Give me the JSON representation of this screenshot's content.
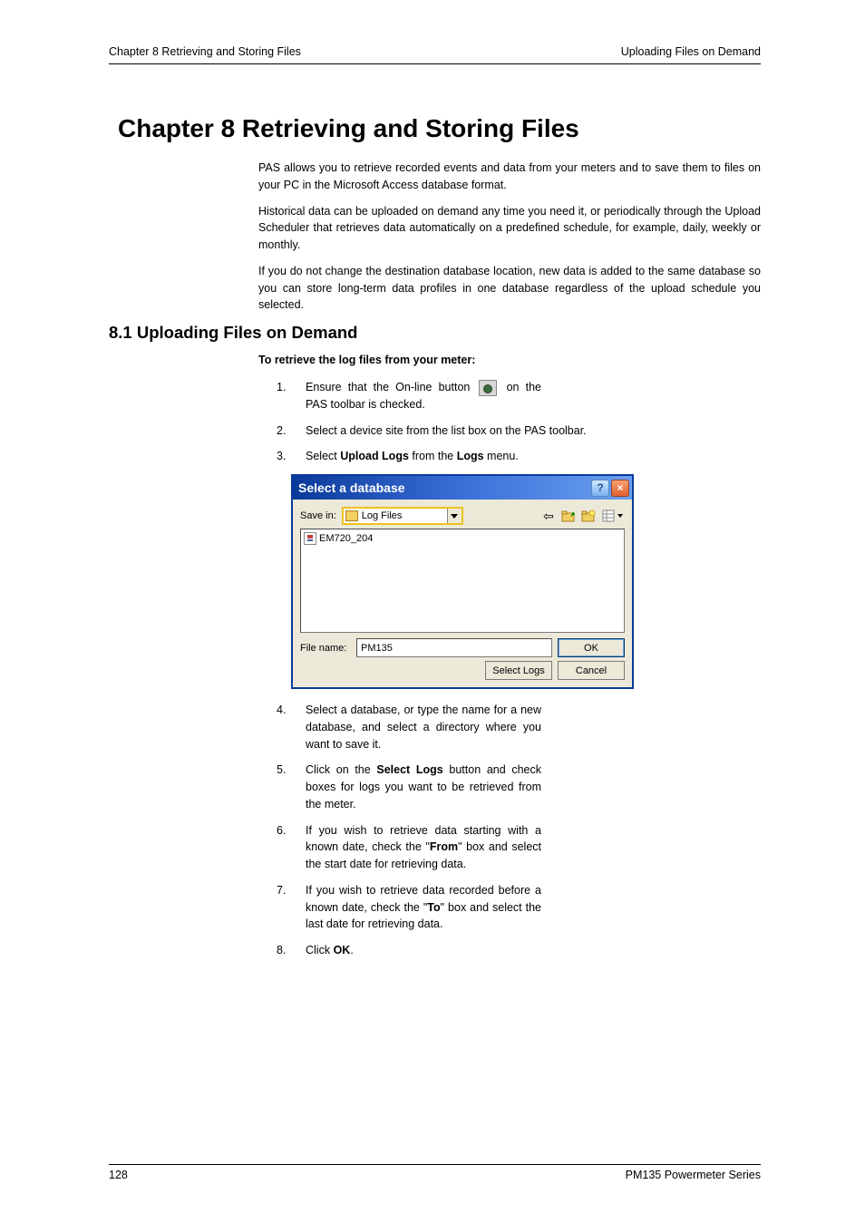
{
  "header": {
    "left": "Chapter 8   Retrieving and Storing Files",
    "right": "Uploading Files on Demand"
  },
  "chapter_title": "Chapter 8   Retrieving and Storing Files",
  "intro": {
    "p1": "PAS allows you to retrieve recorded events and data from your meters and to save them to files on your PC in the Microsoft Access database format.",
    "p2": "Historical data can be uploaded on demand any time you need it, or periodically through the Upload Scheduler that retrieves data automatically on a predefined schedule, for example, daily, weekly or monthly.",
    "p3": "If you do not change the destination database location, new data is added to the same database so you can store long-term data profiles in one database regardless of the upload schedule you selected."
  },
  "section": {
    "title": "8.1  Uploading Files on Demand",
    "sub_heading": "To retrieve the log files from your meter:",
    "steps": {
      "s1a": "Ensure that the On-line button ",
      "s1b": " on the PAS toolbar is checked.",
      "s2": "Select a device site from the list box on the PAS toolbar.",
      "s3a": "Select ",
      "s3b": "Upload Logs",
      "s3c": " from the ",
      "s3d": "Logs",
      "s3e": " menu.",
      "s4": "Select a database, or type the name for a new database, and select a directory where you want to save it.",
      "s5a": "Click on the ",
      "s5b": "Select Logs",
      "s5c": " button and check boxes for logs you want to be retrieved from the meter.",
      "s6a": "If you wish to retrieve data starting with a known date, check the \"",
      "s6b": "From",
      "s6c": "\" box and select the start date for retrieving data.",
      "s7a": "If you wish to retrieve data recorded before a known date, check the \"",
      "s7b": "To",
      "s7c": "\" box and select the last date for retrieving data.",
      "s8a": "Click ",
      "s8b": "OK",
      "s8c": "."
    }
  },
  "dialog": {
    "title": "Select a database",
    "save_in_label": "Save in:",
    "save_in_value": "Log Files",
    "file_item": "EM720_204",
    "file_name_label": "File name:",
    "file_name_value": "PM135",
    "ok_btn": "OK",
    "select_logs_btn": "Select Logs",
    "cancel_btn": "Cancel"
  },
  "footer": {
    "page": "128",
    "series": "PM135 Powermeter Series"
  }
}
